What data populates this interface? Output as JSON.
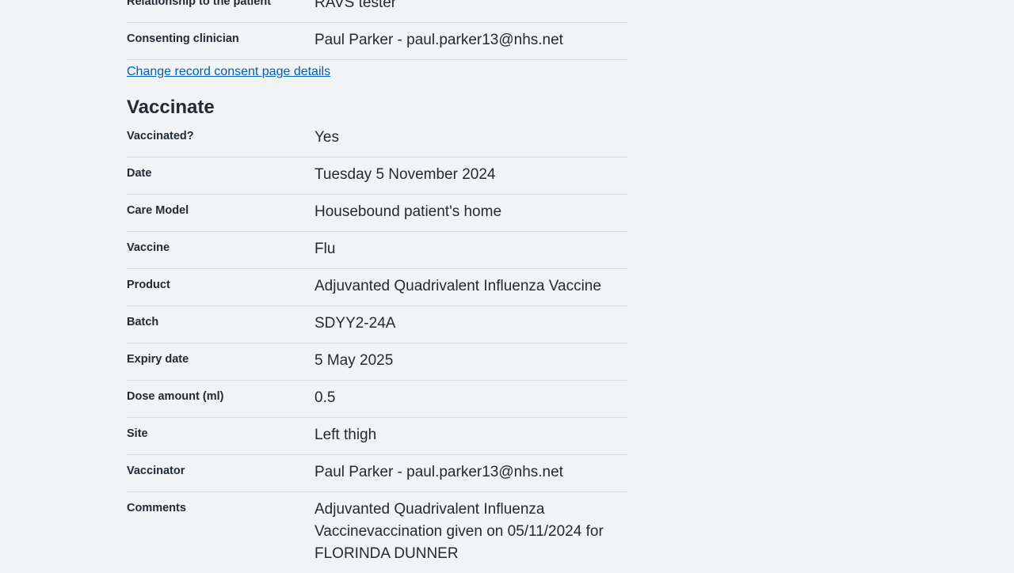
{
  "consent": {
    "rows": [
      {
        "key": "Relationship to the patient",
        "value": "RAVS tester"
      },
      {
        "key": "Consenting clinician",
        "value": "Paul Parker - paul.parker13@nhs.net"
      }
    ],
    "change_link": "Change record consent page details"
  },
  "vaccinate": {
    "heading": "Vaccinate",
    "rows": [
      {
        "key": "Vaccinated?",
        "value": "Yes"
      },
      {
        "key": "Date",
        "value": "Tuesday 5 November 2024"
      },
      {
        "key": "Care Model",
        "value": "Housebound patient's home"
      },
      {
        "key": "Vaccine",
        "value": "Flu"
      },
      {
        "key": "Product",
        "value": "Adjuvanted Quadrivalent Influenza Vaccine"
      },
      {
        "key": "Batch",
        "value": "SDYY2-24A"
      },
      {
        "key": "Expiry date",
        "value": "5 May 2025"
      },
      {
        "key": "Dose amount (ml)",
        "value": "0.5"
      },
      {
        "key": "Site",
        "value": "Left thigh"
      },
      {
        "key": "Vaccinator",
        "value": "Paul Parker - paul.parker13@nhs.net"
      },
      {
        "key": "Comments",
        "value": "Adjuvanted Quadrivalent Influenza Vaccinevaccination given on 05/11/2024 for FLORINDA DUNNER"
      }
    ]
  }
}
